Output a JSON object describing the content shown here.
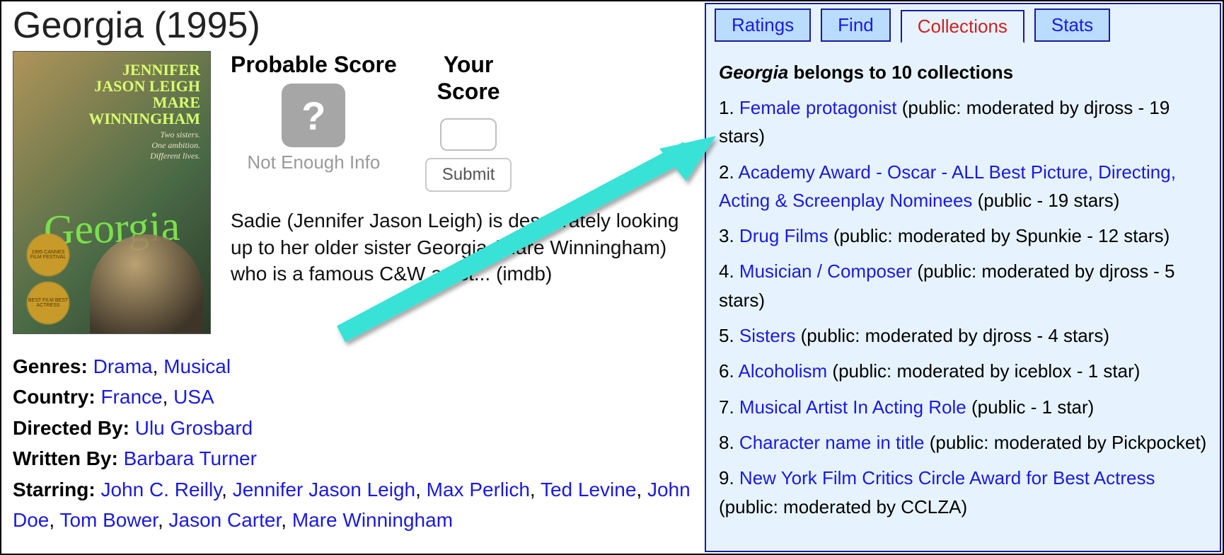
{
  "title": "Georgia (1995)",
  "poster": {
    "names": "JENNIFER\nJASON LEIGH\nMARE\nWINNINGHAM",
    "tagline": "Two sisters.\nOne ambition.\nDifferent lives.",
    "script_title": "Georgia",
    "laurel1": "1995 CANNES FILM FESTIVAL",
    "laurel2": "BEST FILM BEST ACTRESS"
  },
  "scores": {
    "probable_label": "Probable Score",
    "probable_status": "Not Enough Info",
    "your_label": "Your Score",
    "submit_label": "Submit"
  },
  "synopsis": "Sadie (Jennifer Jason Leigh) is desperately looking up to her older sister Georgia (Mare Winningham) who is a famous C&W artist... (imdb)",
  "meta": {
    "genres_label": "Genres:",
    "genres": [
      "Drama",
      "Musical"
    ],
    "country_label": "Country:",
    "countries": [
      "France",
      "USA"
    ],
    "directed_label": "Directed By:",
    "directors": [
      "Ulu Grosbard"
    ],
    "written_label": "Written By:",
    "writers": [
      "Barbara Turner"
    ],
    "starring_label": "Starring:",
    "starring": [
      "John C. Reilly",
      "Jennifer Jason Leigh",
      "Max Perlich",
      "Ted Levine",
      "John Doe",
      "Tom Bower",
      "Jason Carter",
      "Mare Winningham"
    ]
  },
  "tabs": {
    "ratings": "Ratings",
    "find": "Find",
    "collections": "Collections",
    "stats": "Stats"
  },
  "collections_header_prefix": "Georgia",
  "collections_header_rest": " belongs to 10 collections",
  "collections": [
    {
      "name": "Female protagonist",
      "info": "(public: moderated by djross - 19 stars)"
    },
    {
      "name": "Academy Award - Oscar - ALL Best Picture, Directing, Acting & Screenplay Nominees",
      "info": "(public - 19 stars)"
    },
    {
      "name": "Drug Films",
      "info": "(public: moderated by Spunkie - 12 stars)"
    },
    {
      "name": "Musician / Composer",
      "info": "(public: moderated by djross - 5 stars)"
    },
    {
      "name": "Sisters",
      "info": "(public: moderated by djross - 4 stars)"
    },
    {
      "name": "Alcoholism",
      "info": "(public: moderated by iceblox - 1 star)"
    },
    {
      "name": "Musical Artist In Acting Role",
      "info": "(public - 1 star)"
    },
    {
      "name": "Character name in title",
      "info": "(public: moderated by Pickpocket)"
    },
    {
      "name": "New York Film Critics Circle Award for Best Actress",
      "info": "(public: moderated by CCLZA)"
    }
  ]
}
